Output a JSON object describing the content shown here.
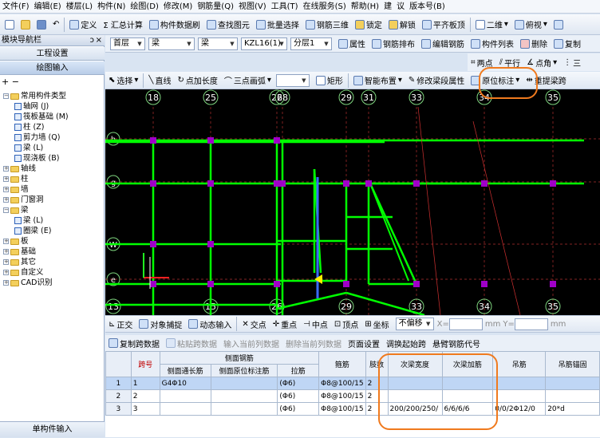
{
  "menu": [
    "文件(F)",
    "编辑(E)",
    "楼层(L)",
    "构件(N)",
    "绘图(D)",
    "修改(M)",
    "钢筋量(Q)",
    "视图(V)",
    "工具(T)",
    "在线服务(S)",
    "帮助(H)",
    "建",
    "议",
    "版本号(B)"
  ],
  "toolbar1": {
    "define": "定义",
    "sum": "Σ 汇总计算",
    "member_data": "构件数据刷",
    "find": "查找图元",
    "batch_select": "批量选择",
    "rebar_3d": "钢筋三维",
    "lock": "锁定",
    "unlock": "解锁",
    "flush_top": "平齐板顶",
    "view2d": "二维",
    "view_top": "俯视",
    "undo_label": "",
    "extra": ""
  },
  "left_panel": {
    "title": "模块导航栏",
    "pin": "ↄ",
    "close": "×",
    "btn_settings": "工程设置",
    "btn_draw": "绘图输入",
    "tools": "+ −",
    "tree": [
      {
        "label": "常用构件类型",
        "level": 0,
        "type": "folder",
        "expanded": true
      },
      {
        "label": "轴网 (J)",
        "level": 1,
        "type": "leaf"
      },
      {
        "label": "筏板基础 (M)",
        "level": 1,
        "type": "leaf"
      },
      {
        "label": "柱 (Z)",
        "level": 1,
        "type": "leaf"
      },
      {
        "label": "剪力墙 (Q)",
        "level": 1,
        "type": "leaf"
      },
      {
        "label": "梁 (L)",
        "level": 1,
        "type": "leaf"
      },
      {
        "label": "现浇板 (B)",
        "level": 1,
        "type": "leaf"
      },
      {
        "label": "轴线",
        "level": 0,
        "type": "folder",
        "expanded": false
      },
      {
        "label": "柱",
        "level": 0,
        "type": "folder",
        "expanded": false
      },
      {
        "label": "墙",
        "level": 0,
        "type": "folder",
        "expanded": false
      },
      {
        "label": "门窗洞",
        "level": 0,
        "type": "folder",
        "expanded": false
      },
      {
        "label": "梁",
        "level": 0,
        "type": "folder",
        "expanded": true
      },
      {
        "label": "梁 (L)",
        "level": 1,
        "type": "leaf"
      },
      {
        "label": "圈梁 (E)",
        "level": 1,
        "type": "leaf"
      },
      {
        "label": "板",
        "level": 0,
        "type": "folder",
        "expanded": false
      },
      {
        "label": "基础",
        "level": 0,
        "type": "folder",
        "expanded": false
      },
      {
        "label": "其它",
        "level": 0,
        "type": "folder",
        "expanded": false
      },
      {
        "label": "自定义",
        "level": 0,
        "type": "folder",
        "expanded": false
      },
      {
        "label": "CAD识别",
        "level": 0,
        "type": "folder",
        "expanded": false
      }
    ],
    "bottom": "单构件输入"
  },
  "toolbar2": {
    "floor": "首层",
    "category": "梁",
    "type": "梁",
    "member": "KZL16(1)",
    "layer": "分层1",
    "attr": "属性",
    "rebar_layout": "钢筋排布",
    "edit_rebar": "编辑钢筋",
    "member_list": "构件列表",
    "delete": "删除",
    "copy": "复制"
  },
  "toolbar3": {
    "two_points": "两点",
    "parallel": "平行",
    "point_angle": "点角",
    "three": "三"
  },
  "toolbar4": {
    "select": "选择",
    "line": "直线",
    "point_len": "点加长度",
    "arc": "三点画弧",
    "rect": "矩形",
    "smart_layout": "智能布置",
    "modify_span": "修改梁段属性",
    "in_situ": "原位标注",
    "re_span": "重提梁跨"
  },
  "canvas": {
    "top_axes": [
      "18",
      "25",
      "26",
      "28",
      "29",
      "31",
      "33",
      "34",
      "35"
    ],
    "bottom_axes": [
      "13",
      "15",
      "26",
      "29",
      "33",
      "34",
      "35"
    ],
    "left_axes": [
      "h",
      "g",
      "W",
      "e"
    ]
  },
  "toolbar5": {
    "ortho": "正交",
    "snap": "对象捕捉",
    "dyn_input": "动态输入",
    "intersect": "交点",
    "midpoint_v": "重点",
    "midpoint": "中点",
    "vertex": "顶点",
    "coord": "坐标",
    "offset": "不偏移",
    "x_label": "X=",
    "x_unit": "mm",
    "y_label": "Y=",
    "y_unit": "mm"
  },
  "toolbar6": {
    "copy_span": "复制跨数据",
    "paste_span": "粘贴跨数据",
    "input_col": "输入当前列数据",
    "del_col": "删除当前列数据",
    "page_setup": "页面设置",
    "adjust_start": "调换起始跨",
    "cantilever": "悬臂钢筋代号"
  },
  "grid": {
    "headers_top": [
      "跨号",
      "侧面钢筋",
      "箍筋",
      "肢数",
      "次梁宽度",
      "次梁加筋",
      "吊筋",
      "吊筋锚固"
    ],
    "headers_sub": [
      "侧面通长筋",
      "侧面原位标注筋",
      "拉筋"
    ],
    "rows": [
      {
        "n": "1",
        "span": "1",
        "side_long": "G4Φ10",
        "side_orig": "",
        "tie": "(Φ6)",
        "stirrup": "Φ8@100/15",
        "legs": "2",
        "sec_width": "",
        "sec_add": "",
        "hanger": "",
        "hanger_anchor": ""
      },
      {
        "n": "2",
        "span": "2",
        "side_long": "",
        "side_orig": "",
        "tie": "(Φ6)",
        "stirrup": "Φ8@100/15",
        "legs": "2",
        "sec_width": "",
        "sec_add": "",
        "hanger": "",
        "hanger_anchor": ""
      },
      {
        "n": "3",
        "span": "3",
        "side_long": "",
        "side_orig": "",
        "tie": "(Φ6)",
        "stirrup": "Φ8@100/15",
        "legs": "2",
        "sec_width": "200/200/250/",
        "sec_add": "6/6/6/6",
        "hanger": "0/0/2Φ12/0",
        "hanger_anchor": "20*d"
      }
    ]
  },
  "colors": {
    "accent": "#f07a1e",
    "beam": "#00ff00",
    "column": "#a000c8",
    "axis": "#7fd67f",
    "canvas_bg": "#000000"
  }
}
